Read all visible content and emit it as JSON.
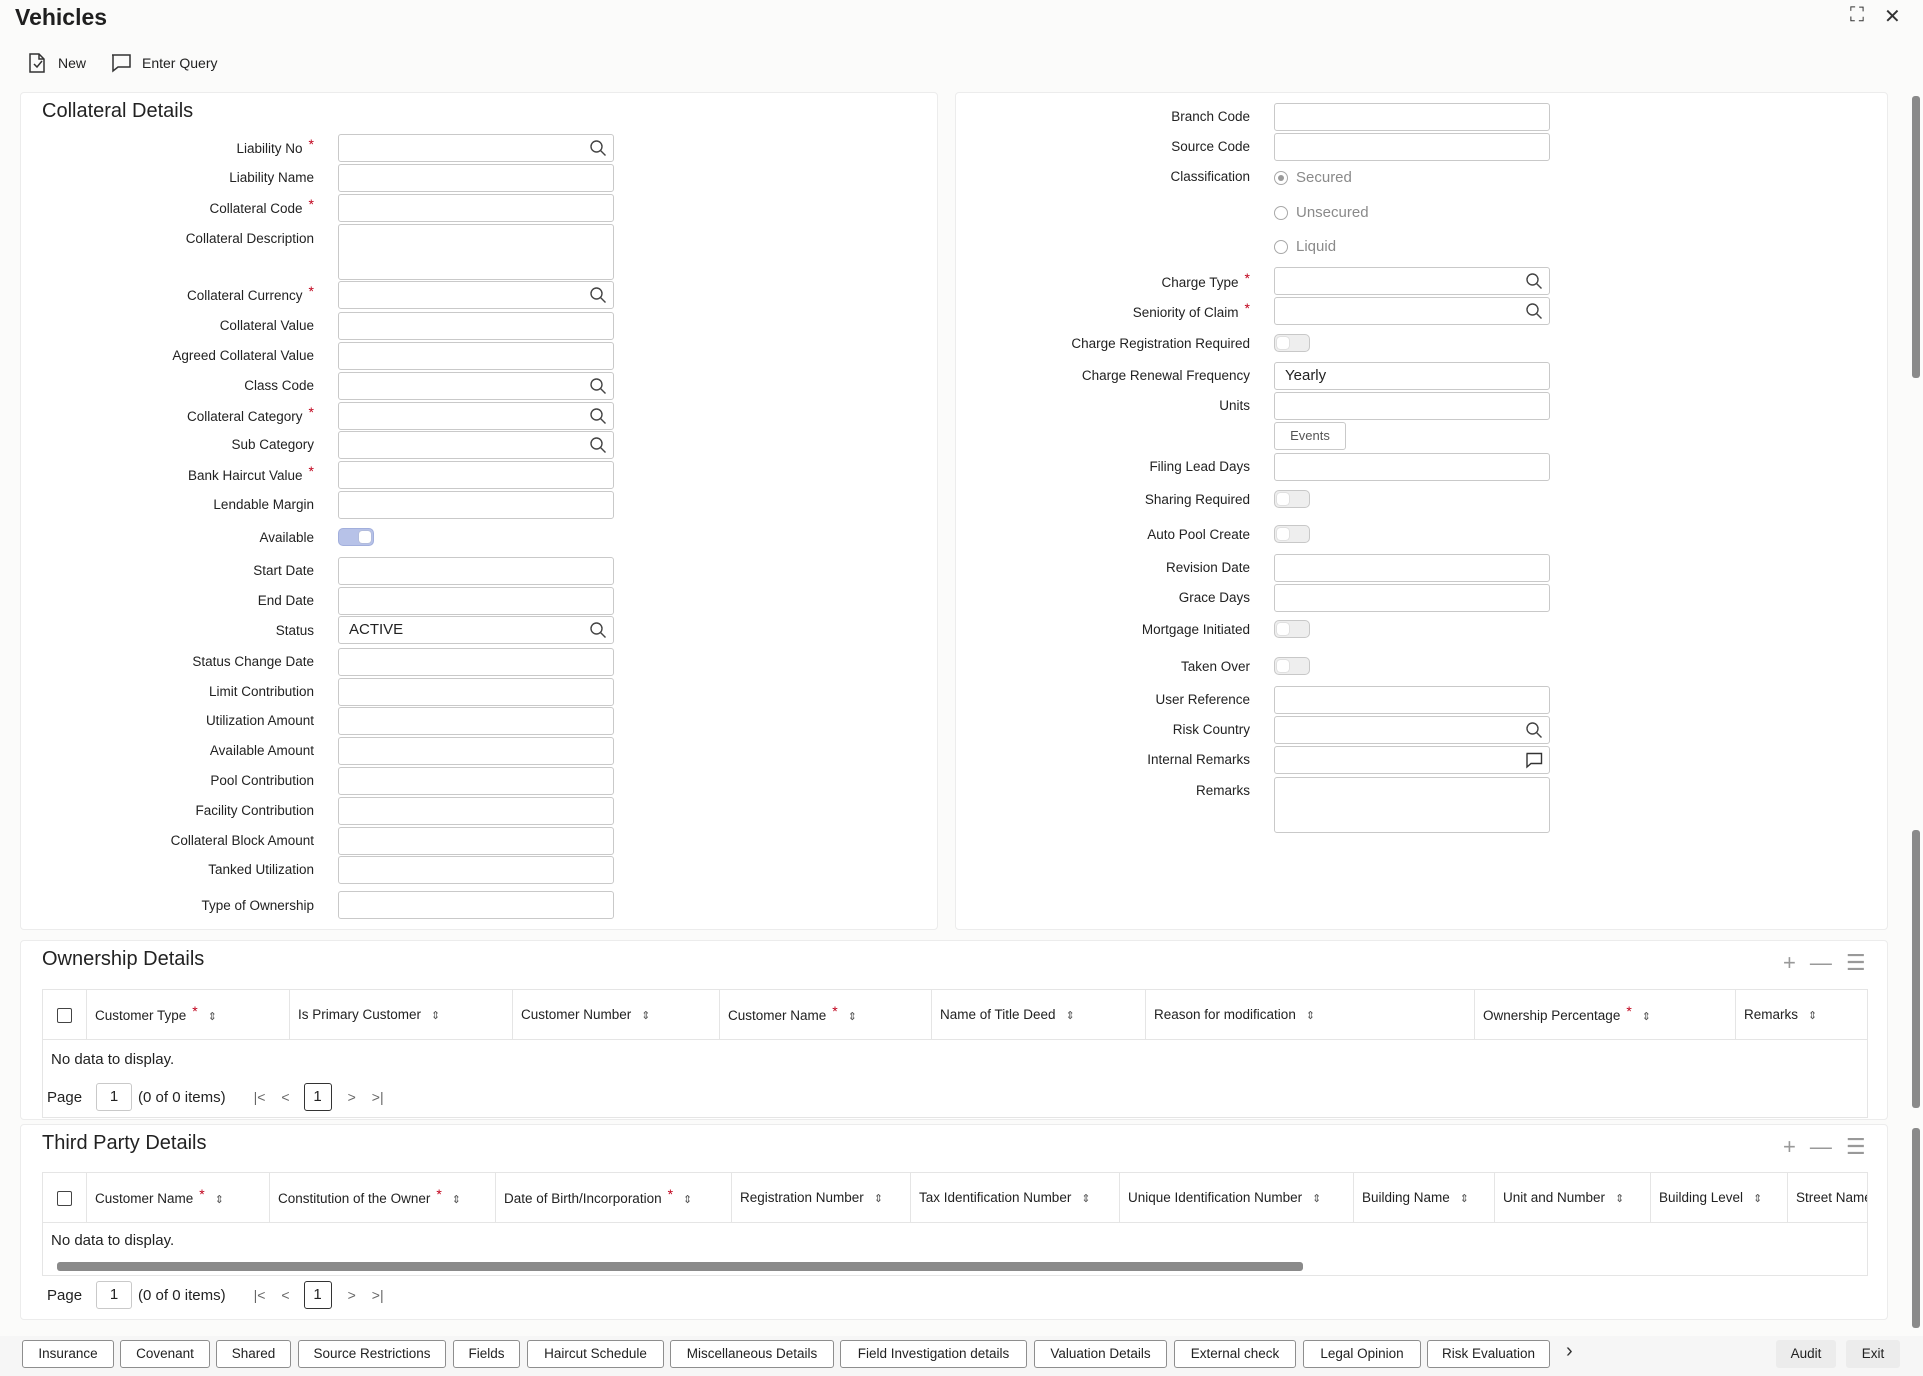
{
  "window": {
    "title": "Vehicles",
    "maximize_glyph": "⛶",
    "close_glyph": "✕"
  },
  "toolbar": {
    "new_label": "New",
    "enter_query_label": "Enter Query"
  },
  "collateral": {
    "title": "Collateral Details",
    "liability_no": "Liability No",
    "liability_name": "Liability Name",
    "collateral_code": "Collateral Code",
    "collateral_description": "Collateral Description",
    "collateral_currency": "Collateral Currency",
    "collateral_value": "Collateral Value",
    "agreed_collateral_value": "Agreed Collateral Value",
    "class_code": "Class Code",
    "collateral_category": "Collateral Category",
    "sub_category": "Sub Category",
    "bank_haircut_value": "Bank Haircut Value",
    "lendable_margin": "Lendable Margin",
    "available": "Available",
    "start_date": "Start Date",
    "end_date": "End Date",
    "status": "Status",
    "status_value": "ACTIVE",
    "status_change_date": "Status Change Date",
    "limit_contribution": "Limit Contribution",
    "utilization_amount": "Utilization Amount",
    "available_amount": "Available Amount",
    "pool_contribution": "Pool Contribution",
    "facility_contribution": "Facility Contribution",
    "collateral_block_amount": "Collateral Block Amount",
    "tanked_utilization": "Tanked Utilization",
    "type_of_ownership": "Type of Ownership",
    "required_mark": "*"
  },
  "right": {
    "branch_code": "Branch Code",
    "source_code": "Source Code",
    "classification": "Classification",
    "secured": "Secured",
    "unsecured": "Unsecured",
    "liquid": "Liquid",
    "charge_type": "Charge Type",
    "seniority_of_claim": "Seniority of Claim",
    "charge_registration_required": "Charge Registration Required",
    "charge_renewal_frequency": "Charge Renewal Frequency",
    "charge_renewal_value": "Yearly",
    "units": "Units",
    "events": "Events",
    "filing_lead_days": "Filing Lead Days",
    "sharing_required": "Sharing Required",
    "auto_pool_create": "Auto Pool Create",
    "revision_date": "Revision Date",
    "grace_days": "Grace Days",
    "mortgage_initiated": "Mortgage Initiated",
    "taken_over": "Taken Over",
    "user_reference": "User Reference",
    "risk_country": "Risk Country",
    "internal_remarks": "Internal Remarks",
    "remarks": "Remarks"
  },
  "ownership": {
    "title": "Ownership Details",
    "columns": [
      "Customer Type",
      "Is Primary Customer",
      "Customer Number",
      "Customer Name",
      "Name of Title Deed",
      "Reason for modification",
      "Ownership Percentage",
      "Remarks"
    ],
    "no_data": "No data to display.",
    "page_label": "Page",
    "page_value": "1",
    "items_text": "(0 of 0 items)",
    "current_page": "1"
  },
  "third_party": {
    "title": "Third Party Details",
    "columns": [
      "Customer Name",
      "Constitution of the Owner",
      "Date of Birth/Incorporation",
      "Registration Number",
      "Tax Identification Number",
      "Unique Identification Number",
      "Building Name",
      "Unit and Number",
      "Building Level",
      "Street Name"
    ],
    "no_data": "No data to display.",
    "page_label": "Page",
    "page_value": "1",
    "items_text": "(0 of 0 items)",
    "current_page": "1"
  },
  "bottom_tabs": [
    "Insurance",
    "Covenant",
    "Shared",
    "Source Restrictions",
    "Fields",
    "Haircut Schedule",
    "Miscellaneous Details",
    "Field Investigation details",
    "Valuation Details",
    "External check",
    "Legal Opinion",
    "Risk Evaluation"
  ],
  "bottom_actions": {
    "audit": "Audit",
    "exit": "Exit"
  }
}
